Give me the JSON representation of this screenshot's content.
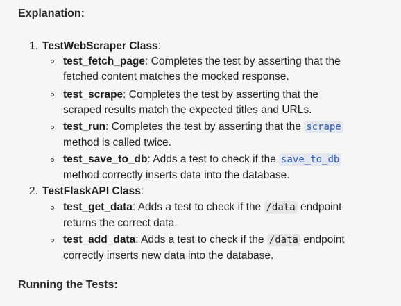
{
  "headings": {
    "explanation": "Explanation:",
    "running": "Running the Tests:"
  },
  "section1": {
    "number": "1.",
    "title": "TestWebScraper Class",
    "colon": ":",
    "items": [
      {
        "name": "test_fetch_page",
        "line1": ": Completes the test by asserting that the",
        "line2": "fetched content matches the mocked response."
      },
      {
        "name": "test_scrape",
        "line1": ": Completes the test by asserting that the",
        "line2": "scraped results match the expected titles and URLs."
      },
      {
        "name": "test_run",
        "line1": ": Completes the test by asserting that the ",
        "code": "scrape",
        "line2": "method is called twice."
      },
      {
        "name": "test_save_to_db",
        "line1": ": Adds a test to check if the ",
        "code": "save_to_db",
        "line2": "method correctly inserts data into the database."
      }
    ]
  },
  "section2": {
    "number": "2.",
    "title": "TestFlaskAPI Class",
    "colon": ":",
    "items": [
      {
        "name": "test_get_data",
        "line1": ": Adds a test to check if the ",
        "code": "/data",
        "after_code": " endpoint",
        "line2": "returns the correct data."
      },
      {
        "name": "test_add_data",
        "line1": ": Adds a test to check if the ",
        "code": "/data",
        "after_code": " endpoint",
        "line2": "correctly inserts new data into the database."
      }
    ]
  }
}
